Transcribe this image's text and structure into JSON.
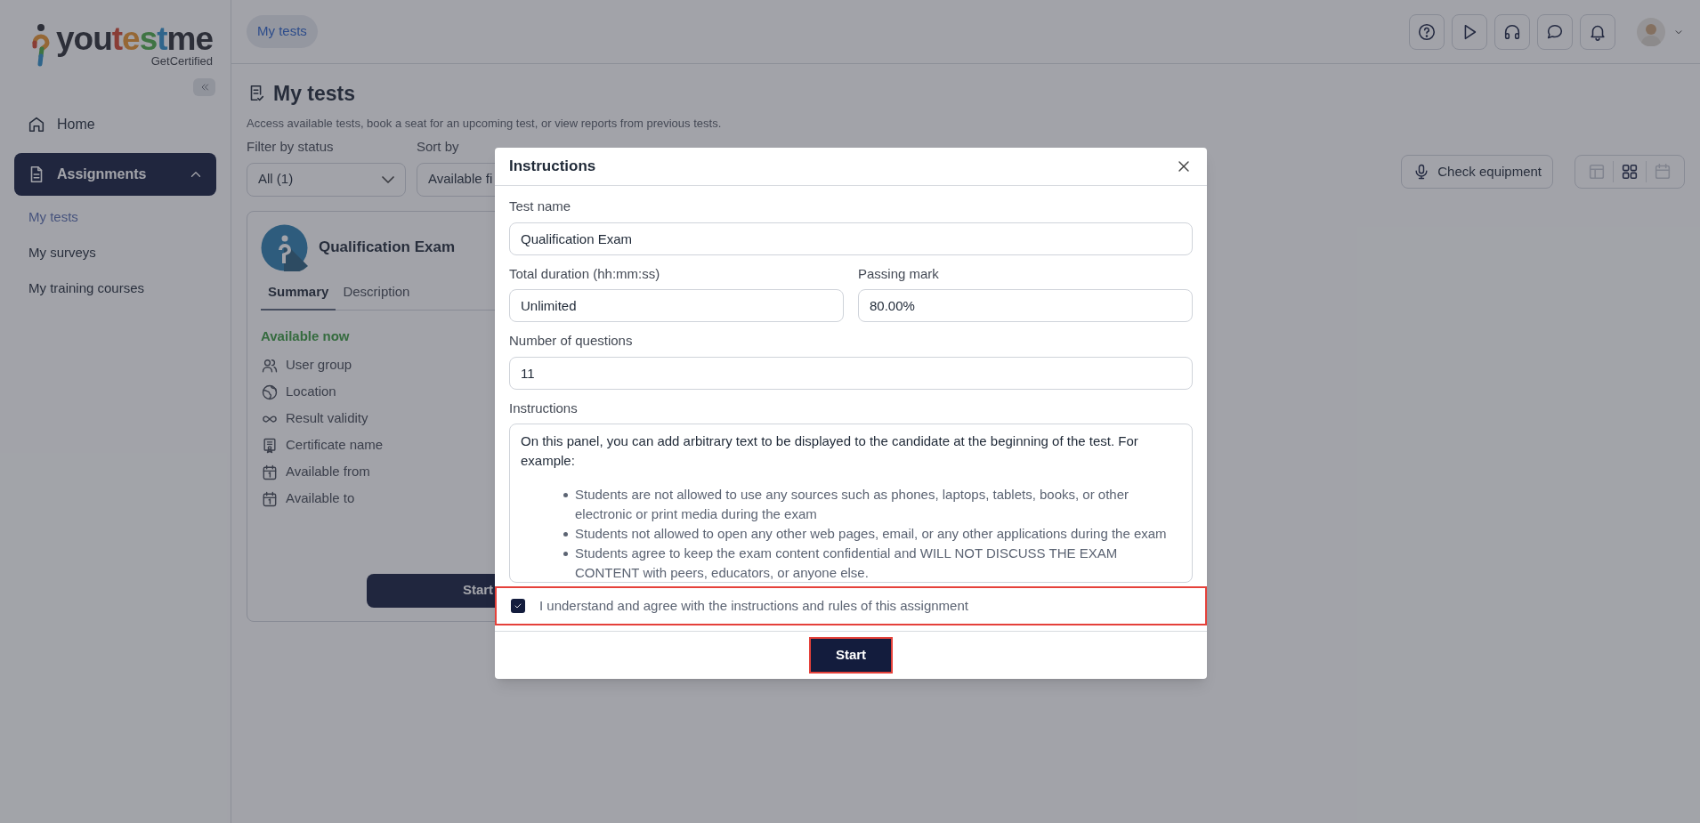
{
  "logo": {
    "segments": [
      "you",
      "t",
      "e",
      "s",
      "t",
      "me"
    ],
    "tagline": "GetCertified"
  },
  "sidebar": {
    "items": [
      {
        "label": "Home",
        "selected": false
      },
      {
        "label": "Assignments",
        "selected": true,
        "expanded": true,
        "children": [
          {
            "label": "My tests",
            "selected": true
          },
          {
            "label": "My surveys",
            "selected": false
          },
          {
            "label": "My training courses",
            "selected": false
          }
        ]
      }
    ]
  },
  "topbar": {
    "breadcrumb": "My tests"
  },
  "page": {
    "title": "My tests",
    "description": "Access available tests, book a seat for an upcoming test, or view reports from previous tests.",
    "filters": [
      {
        "label": "Filter by status",
        "value": "All (1)"
      },
      {
        "label": "Sort by",
        "value": "Available fi"
      }
    ],
    "check_equipment": "Check equipment",
    "views": [
      {
        "kind": "table",
        "selected": false
      },
      {
        "kind": "grid",
        "selected": true
      },
      {
        "kind": "calendar",
        "selected": false
      }
    ]
  },
  "card": {
    "title": "Qualification Exam",
    "tabs": [
      {
        "label": "Summary",
        "selected": true
      },
      {
        "label": "Description",
        "selected": false
      }
    ],
    "status": "Available now",
    "rows": [
      {
        "kind": "users",
        "label": "User group"
      },
      {
        "kind": "globe",
        "label": "Location"
      },
      {
        "kind": "infinity",
        "label": "Result validity"
      },
      {
        "kind": "certificate",
        "label": "Certificate name"
      },
      {
        "kind": "calendar",
        "label": "Available from"
      },
      {
        "kind": "calendar",
        "label": "Available to"
      }
    ],
    "button": "Start"
  },
  "modal": {
    "title": "Instructions",
    "fields": [
      {
        "label": "Test name",
        "value": "Qualification Exam",
        "half": false
      },
      {
        "label": "Total duration (hh:mm:ss)",
        "value": "Unlimited",
        "half": true
      },
      {
        "label": "Passing mark",
        "value": "80.00%",
        "half": true
      },
      {
        "label": "Number of questions",
        "value": "11",
        "half": false
      }
    ],
    "instructions": {
      "label": "Instructions",
      "intro": "On this panel, you can add arbitrary text to be displayed to the candidate at the beginning of the test. For example:",
      "bullets": [
        "Students are not allowed to use any sources such as phones, laptops, tablets, books, or other electronic or print media during the exam",
        "Students not allowed to open any other web pages, email, or any other applications during the exam",
        "Students agree to keep the exam content confidential and WILL NOT DISCUSS THE EXAM CONTENT with peers, educators, or anyone else."
      ]
    },
    "agree": {
      "label": "I understand and agree with the instructions and rules of this assignment",
      "checked": true,
      "highlighted": true
    },
    "start": {
      "label": "Start",
      "highlighted": true
    }
  }
}
